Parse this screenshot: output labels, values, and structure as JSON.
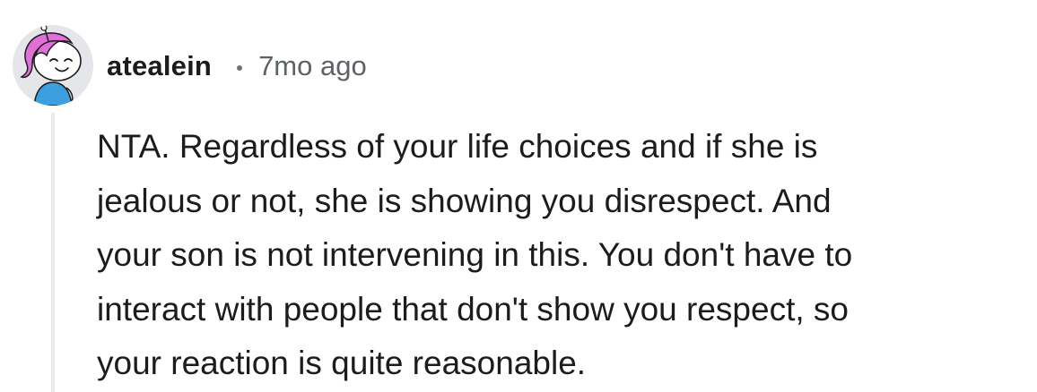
{
  "comment": {
    "username": "atealein",
    "separator": "•",
    "timestamp": "7mo ago",
    "avatar_icon": "snoo-avatar-pink-hair",
    "body_lines": [
      "NTA. Regardless of your life choices and if she is",
      "jealous or not, she is showing you disrespect. And",
      "your son is not intervening in this. You don't have to",
      "interact with people that don't show you respect, so",
      "your reaction is quite reasonable."
    ]
  },
  "colors": {
    "text": "#1c1c1c",
    "meta": "#5d6266",
    "thread_line": "#e8eaec",
    "avatar_bg": "#e4e6e9",
    "hair": "#e070d8",
    "shirt": "#3b9fe0"
  }
}
